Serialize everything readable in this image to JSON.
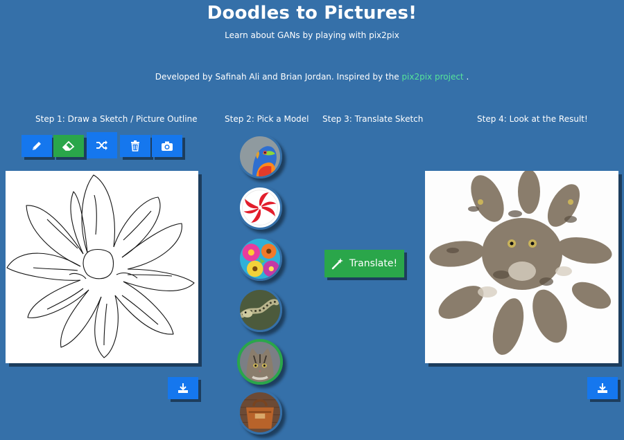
{
  "header": {
    "title": "Doodles to Pictures!",
    "subtitle": "Learn about GANs by playing with pix2pix",
    "credits_prefix": "Developed by Safinah Ali and Brian Jordan. Inspired by the ",
    "credits_link": "pix2pix project",
    "credits_suffix": " ."
  },
  "steps": {
    "step1": "Step 1: Draw a Sketch / Picture Outline",
    "step2": "Step 2: Pick a Model",
    "step3": "Step 3: Translate Sketch",
    "step4": "Step 4: Look at the Result!"
  },
  "toolbar": {
    "tools": [
      "pencil-icon",
      "eraser-icon",
      "shuffle-icon",
      "trash-icon",
      "camera-icon"
    ],
    "active_tool": "shuffle-icon"
  },
  "models": [
    "parrot",
    "candy",
    "flowers",
    "snake",
    "cat",
    "handbag"
  ],
  "selected_model": "cat",
  "translate": {
    "label": "Translate!",
    "icon": "magic-wand-icon"
  },
  "colors": {
    "background": "#3570a9",
    "primary_button": "#1577ee",
    "success_button": "#2aa64a",
    "link": "#56e39a"
  }
}
